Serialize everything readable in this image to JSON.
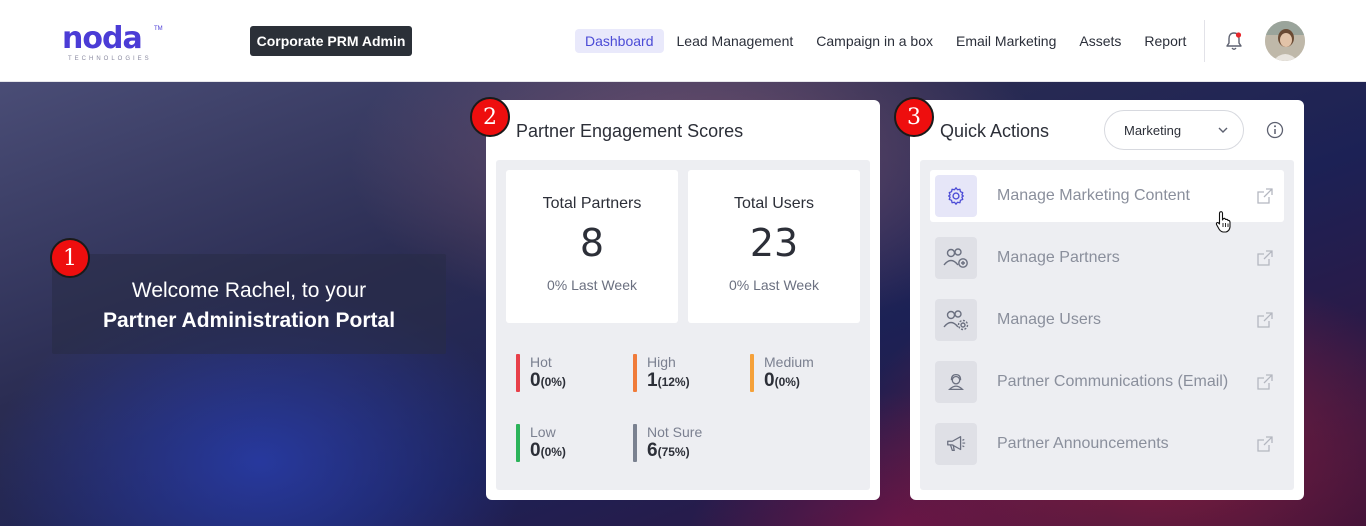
{
  "header": {
    "logo_word": "noda",
    "logo_sub": "TECHNOLOGIES",
    "logo_tm": "TM",
    "role_badge": "Corporate PRM Admin",
    "nav": [
      {
        "label": "Dashboard",
        "active": true
      },
      {
        "label": "Lead Management",
        "active": false
      },
      {
        "label": "Campaign in a box",
        "active": false
      },
      {
        "label": "Email Marketing",
        "active": false
      },
      {
        "label": "Assets",
        "active": false
      },
      {
        "label": "Report",
        "active": false
      }
    ],
    "icons": {
      "bell": "bell-icon",
      "avatar": "user-avatar"
    }
  },
  "steps": [
    "1",
    "2",
    "3"
  ],
  "welcome": {
    "line1": "Welcome Rachel, to your",
    "line2": "Partner Administration Portal"
  },
  "engagement": {
    "title": "Partner Engagement Scores",
    "total_partners": {
      "label": "Total Partners",
      "value": "8",
      "sub": "0% Last Week"
    },
    "total_users": {
      "label": "Total Users",
      "value": "23",
      "sub": "0% Last Week"
    },
    "levels": [
      {
        "name": "Hot",
        "value": "0",
        "pct": "(0%)",
        "color": "#e8404a"
      },
      {
        "name": "High",
        "value": "1",
        "pct": "(12%)",
        "color": "#f07b3a"
      },
      {
        "name": "Medium",
        "value": "0",
        "pct": "(0%)",
        "color": "#f5a13a"
      },
      {
        "name": "Low",
        "value": "0",
        "pct": "(0%)",
        "color": "#2bb35a"
      },
      {
        "name": "Not Sure",
        "value": "6",
        "pct": "(75%)",
        "color": "#7a8190"
      }
    ]
  },
  "quick_actions": {
    "title": "Quick Actions",
    "filter": {
      "selected": "Marketing"
    },
    "items": [
      {
        "label": "Manage Marketing Content",
        "icon": "gear-icon"
      },
      {
        "label": "Manage Partners",
        "icon": "users-add-icon"
      },
      {
        "label": "Manage Users",
        "icon": "users-settings-icon"
      },
      {
        "label": "Partner Communications (Email)",
        "icon": "contact-icon"
      },
      {
        "label": "Partner Announcements",
        "icon": "megaphone-icon"
      }
    ]
  },
  "colors": {
    "accent": "#4b3cd6",
    "step_badge": "#ee0e0e",
    "badge_bg": "#2b3038"
  }
}
